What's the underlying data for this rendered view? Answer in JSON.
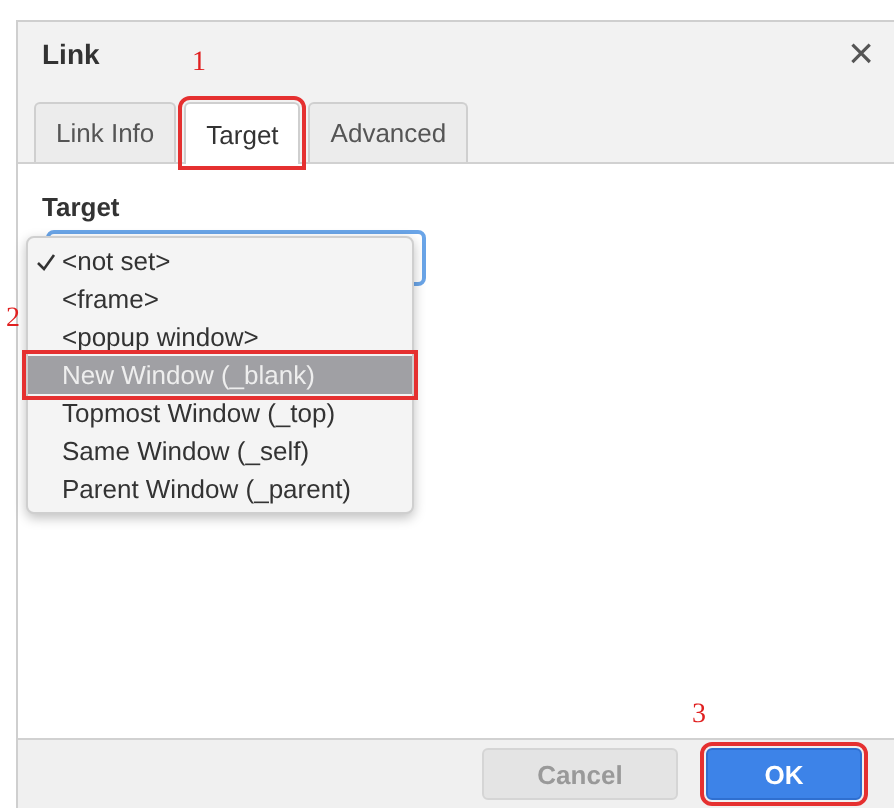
{
  "dialog": {
    "title": "Link",
    "close": "×"
  },
  "tabs": [
    {
      "label": "Link Info",
      "selected": false
    },
    {
      "label": "Target",
      "selected": true,
      "callout": "1"
    },
    {
      "label": "Advanced",
      "selected": false
    }
  ],
  "field": {
    "label": "Target",
    "expanded": true
  },
  "options": [
    {
      "label": "<not set>",
      "checked": true,
      "selected": false
    },
    {
      "label": "<frame>",
      "checked": false,
      "selected": false
    },
    {
      "label": "<popup window>",
      "checked": false,
      "selected": false
    },
    {
      "label": "New Window (_blank)",
      "checked": false,
      "selected": true,
      "callout": "2"
    },
    {
      "label": "Topmost Window (_top)",
      "checked": false,
      "selected": false
    },
    {
      "label": "Same Window (_self)",
      "checked": false,
      "selected": false
    },
    {
      "label": "Parent Window (_parent)",
      "checked": false,
      "selected": false
    }
  ],
  "buttons": [
    {
      "label": "Cancel",
      "kind": "secondary"
    },
    {
      "label": "OK",
      "kind": "primary",
      "callout": "3"
    }
  ]
}
